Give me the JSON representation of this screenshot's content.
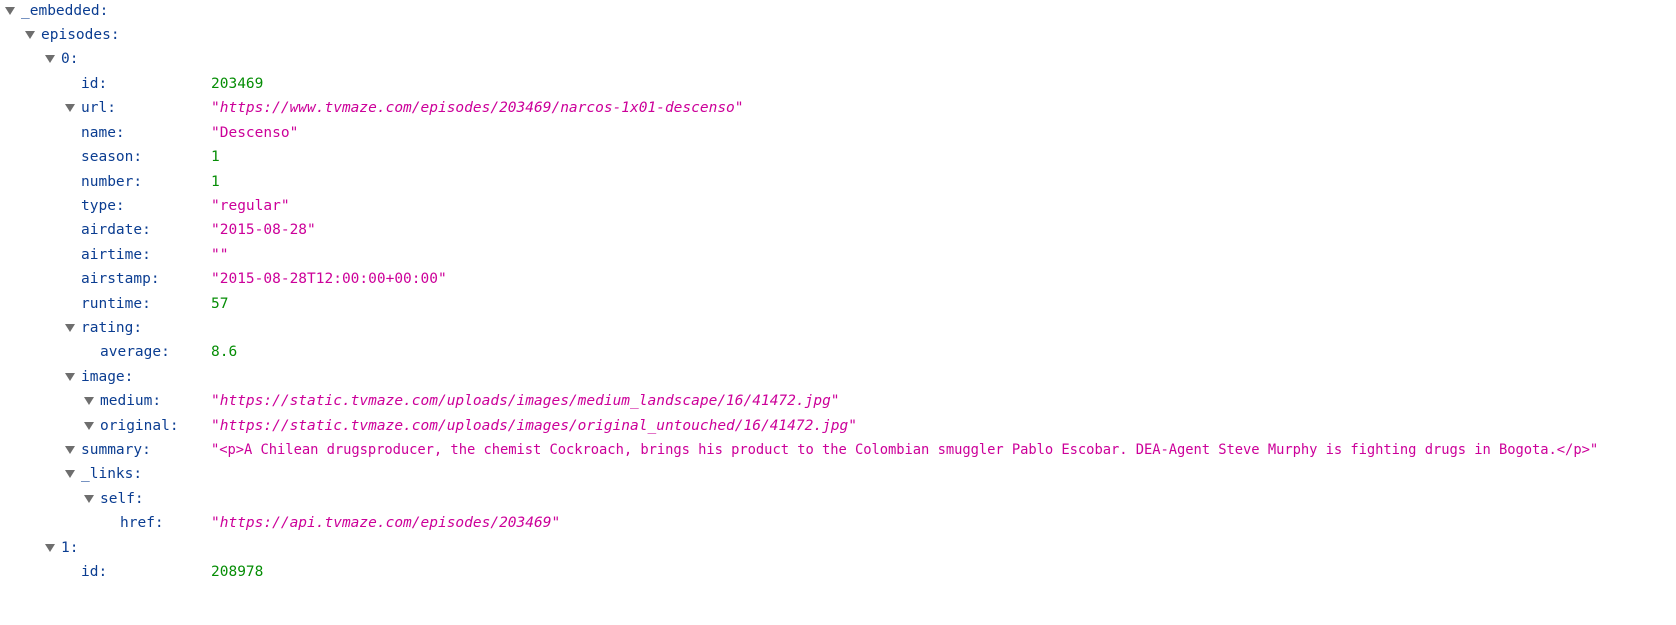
{
  "tree": {
    "embedded_key": "_embedded:",
    "episodes_key": "episodes:",
    "ep0": {
      "index_key": "0:",
      "id": {
        "key": "id:",
        "value": "203469"
      },
      "url": {
        "key": "url:",
        "value": "\"https://www.tvmaze.com/episodes/203469/narcos-1x01-descenso\""
      },
      "name": {
        "key": "name:",
        "value": "\"Descenso\""
      },
      "season": {
        "key": "season:",
        "value": "1"
      },
      "number": {
        "key": "number:",
        "value": "1"
      },
      "type": {
        "key": "type:",
        "value": "\"regular\""
      },
      "airdate": {
        "key": "airdate:",
        "value": "\"2015-08-28\""
      },
      "airtime": {
        "key": "airtime:",
        "value": "\"\""
      },
      "airstamp": {
        "key": "airstamp:",
        "value": "\"2015-08-28T12:00:00+00:00\""
      },
      "runtime": {
        "key": "runtime:",
        "value": "57"
      },
      "rating": {
        "key": "rating:",
        "average": {
          "key": "average:",
          "value": "8.6"
        }
      },
      "image": {
        "key": "image:",
        "medium": {
          "key": "medium:",
          "value": "\"https://static.tvmaze.com/uploads/images/medium_landscape/16/41472.jpg\""
        },
        "original": {
          "key": "original:",
          "value": "\"https://static.tvmaze.com/uploads/images/original_untouched/16/41472.jpg\""
        }
      },
      "summary": {
        "key": "summary:",
        "value": "\"<p>A Chilean drugsproducer, the chemist Cockroach, brings his product to the Colombian smuggler Pablo Escobar. DEA-Agent Steve Murphy is fighting drugs in Bogota.</p>\""
      },
      "links": {
        "key": "_links:",
        "self": {
          "key": "self:",
          "href": {
            "key": "href:",
            "value": "\"https://api.tvmaze.com/episodes/203469\""
          }
        }
      }
    },
    "ep1": {
      "index_key": "1:",
      "id": {
        "key": "id:",
        "value": "208978"
      }
    }
  },
  "colors": {
    "key": "#0b3d91",
    "string": "#cc0099",
    "number": "#058d05",
    "twisty": "#6e6e6e"
  }
}
